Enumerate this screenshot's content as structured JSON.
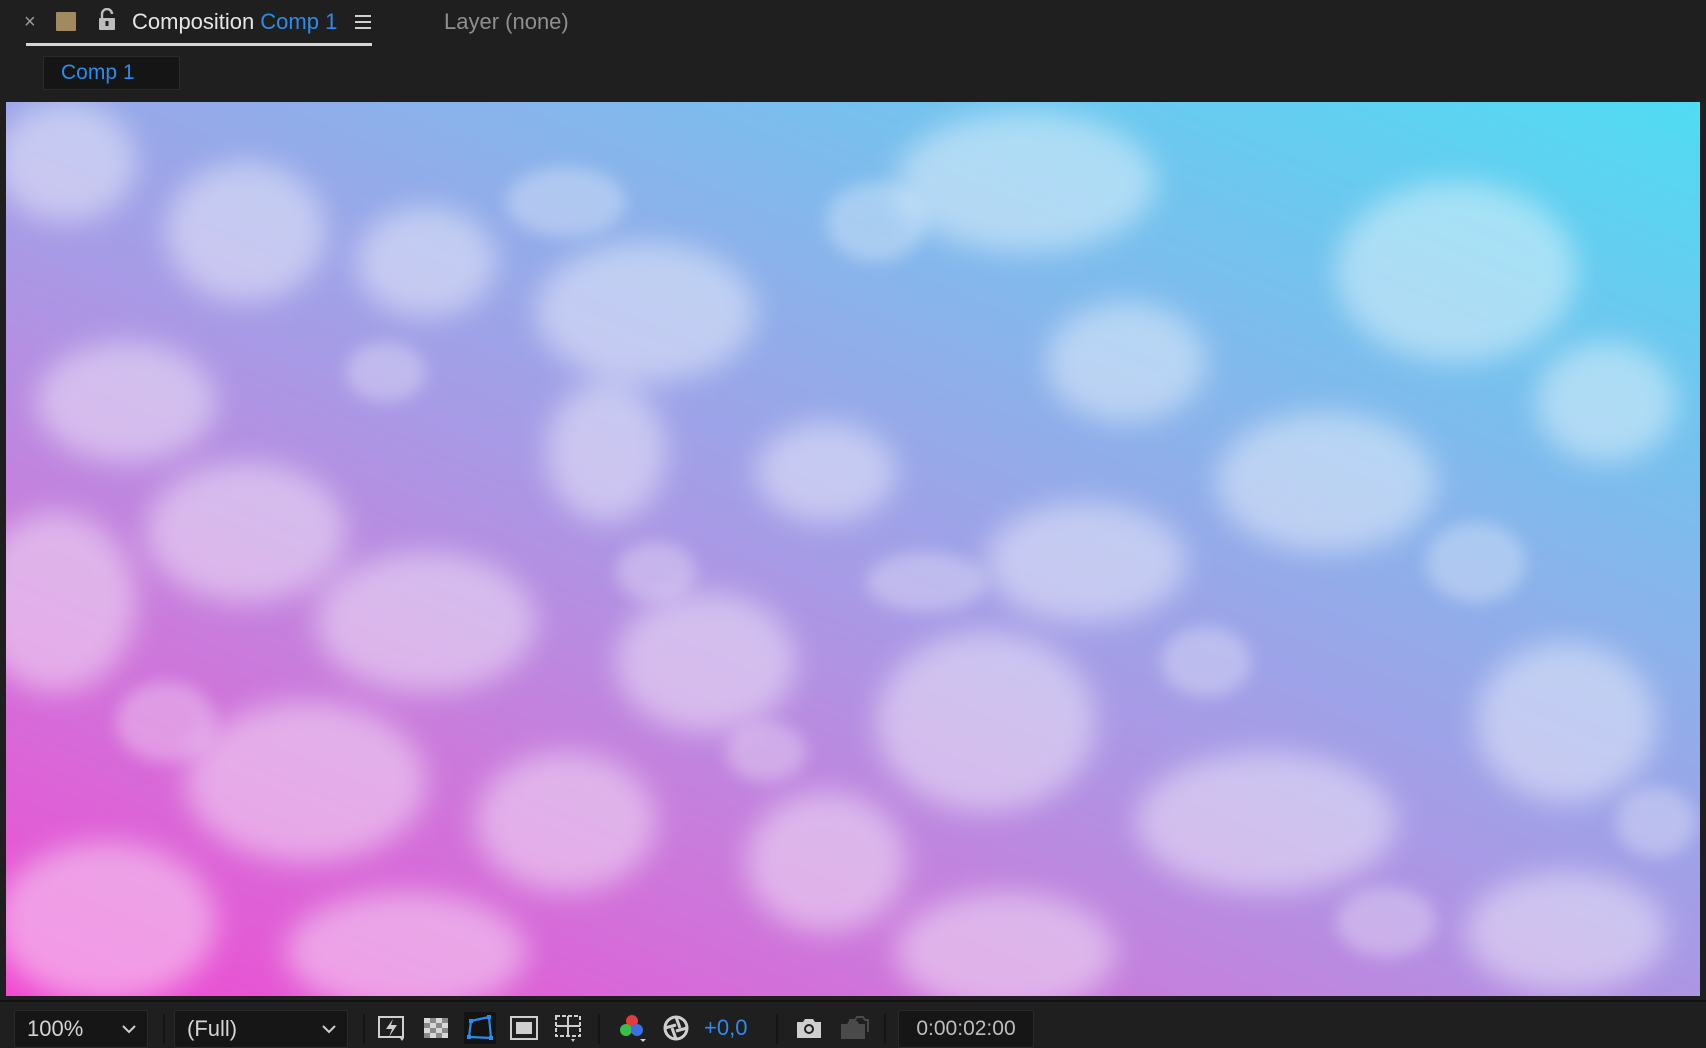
{
  "panel": {
    "close_glyph": "×",
    "title_prefix": "Composition",
    "comp_name": "Comp 1",
    "layer_tab": "Layer (none)",
    "label_color": "#a08a5f",
    "accent_color": "#2d8ceb"
  },
  "breadcrumb": {
    "item": "Comp 1"
  },
  "viewer": {
    "content": "sky-clouds-gradient",
    "gradient_colors": [
      "#f04ad2",
      "#c97cdc",
      "#a79be6",
      "#84b7ec",
      "#50dcf3"
    ]
  },
  "toolbar": {
    "zoom": "100%",
    "resolution": "(Full)",
    "exposure": "+0,0",
    "timecode": "0:00:02:00",
    "icons": [
      "fast-previews-icon",
      "transparency-grid-icon",
      "mask-path-visibility-icon",
      "region-of-interest-icon",
      "title-action-safe-icon",
      "channel-rgb-icon",
      "reset-exposure-icon",
      "snapshot-camera-icon",
      "show-snapshot-icon"
    ]
  }
}
